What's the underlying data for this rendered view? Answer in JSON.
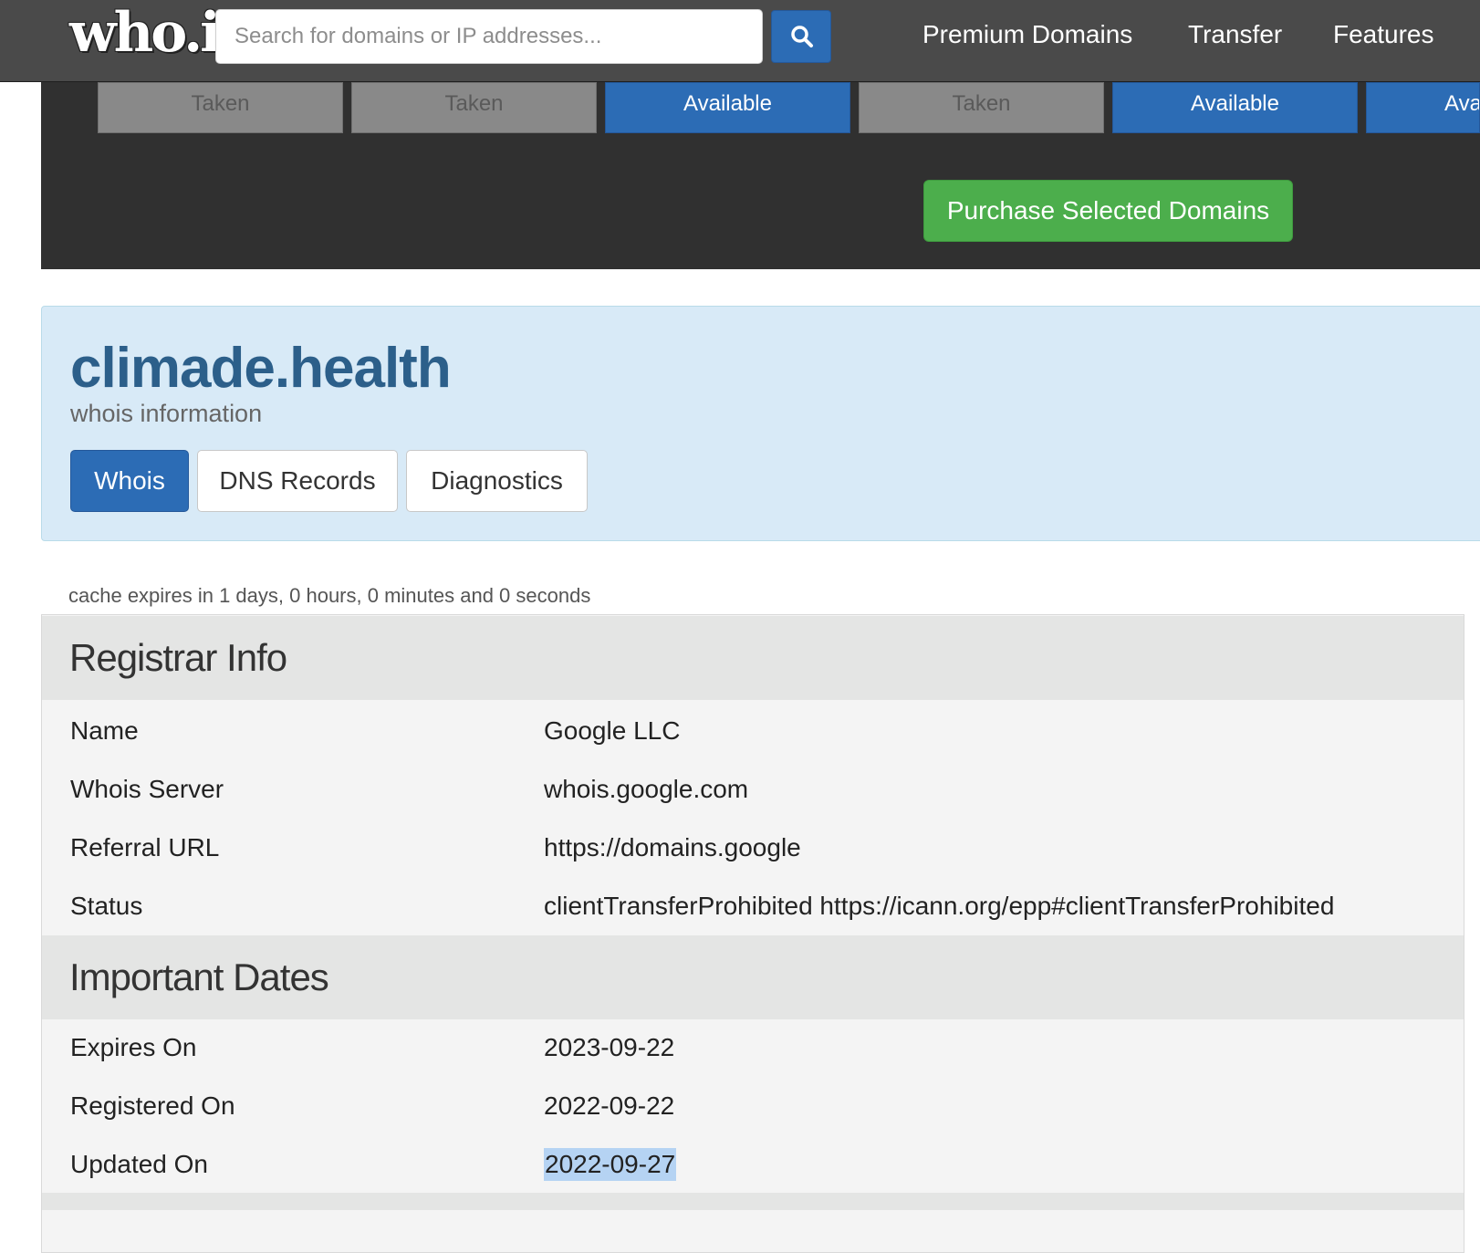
{
  "header": {
    "logo_text": "who.is",
    "search_placeholder": "Search for domains or IP addresses...",
    "search_button_icon": "magnifier-icon",
    "nav": [
      {
        "label": "Premium Domains"
      },
      {
        "label": "Transfer"
      },
      {
        "label": "Features"
      }
    ]
  },
  "suggestions": {
    "tiles": [
      {
        "status": "Taken"
      },
      {
        "status": "Taken"
      },
      {
        "status": "Available"
      },
      {
        "status": "Taken"
      },
      {
        "status": "Available"
      },
      {
        "status": "Available"
      }
    ],
    "purchase_label": "Purchase Selected Domains"
  },
  "domain": {
    "name": "climade.health",
    "subtitle": "whois information",
    "tabs": [
      {
        "label": "Whois",
        "active": true
      },
      {
        "label": "DNS Records",
        "active": false
      },
      {
        "label": "Diagnostics",
        "active": false
      }
    ]
  },
  "cache_note": "cache expires in 1 days, 0 hours, 0 minutes and 0 seconds",
  "registrar": {
    "title": "Registrar Info",
    "rows": [
      {
        "label": "Name",
        "value": "Google LLC"
      },
      {
        "label": "Whois Server",
        "value": "whois.google.com"
      },
      {
        "label": "Referral URL",
        "value": "https://domains.google"
      },
      {
        "label": "Status",
        "value": "clientTransferProhibited https://icann.org/epp#clientTransferProhibited"
      }
    ]
  },
  "dates": {
    "title": "Important Dates",
    "rows": [
      {
        "label": "Expires On",
        "value": "2023-09-22"
      },
      {
        "label": "Registered On",
        "value": "2022-09-22"
      },
      {
        "label": "Updated On",
        "value": "2022-09-27",
        "selected": true
      }
    ]
  },
  "colors": {
    "navbar": "#4a4a4a",
    "primary_blue": "#2c6cb5",
    "success_green": "#4cae4c",
    "panel_blue": "#d8eaf7",
    "domain_title": "#2c5f8a"
  }
}
